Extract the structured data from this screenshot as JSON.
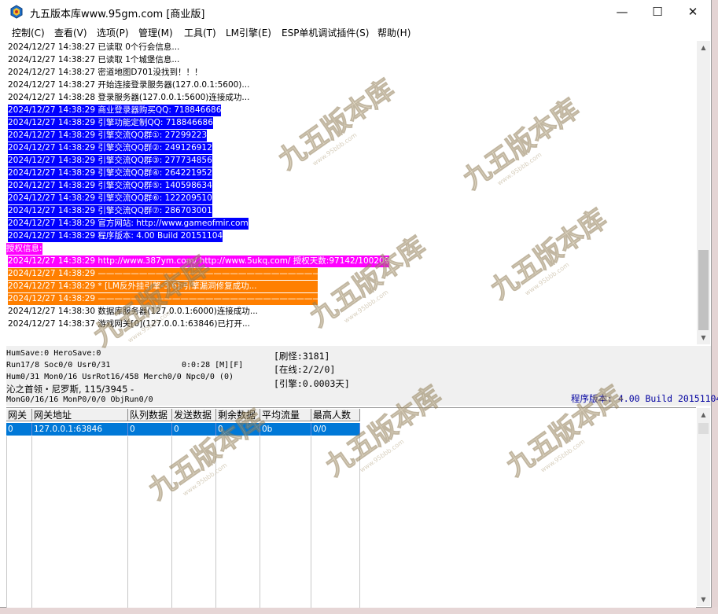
{
  "window": {
    "title": "九五版本库www.95gm.com [商业版]",
    "controls": {
      "minimize": "—",
      "maximize": "☐",
      "close": "✕"
    }
  },
  "menu": [
    "控制(C)",
    "查看(V)",
    "选项(P)",
    "管理(M)",
    "工具(T)",
    "LM引擎(E)",
    "ESP单机调试插件(S)",
    "帮助(H)"
  ],
  "log": [
    {
      "text": "2024/12/27 14:38:27 已读取 0个行会信息...",
      "fg": "#000000",
      "bg": ""
    },
    {
      "text": "2024/12/27 14:38:27 已读取 1个城堡信息...",
      "fg": "#000000",
      "bg": ""
    },
    {
      "text": "2024/12/27 14:38:27 密道地图D701没找到！！！",
      "fg": "#000000",
      "bg": ""
    },
    {
      "text": "2024/12/27 14:38:27 开始连接登录服务器(127.0.0.1:5600)...",
      "fg": "#000000",
      "bg": ""
    },
    {
      "text": "2024/12/27 14:38:28 登录服务器(127.0.0.1:5600)连接成功...",
      "fg": "#000000",
      "bg": ""
    },
    {
      "text": "2024/12/27 14:38:29 商业登录器购买QQ: 718846686",
      "fg": "#ffffff",
      "bg": "#0000ff"
    },
    {
      "text": "2024/12/27 14:38:29 引擎功能定制QQ: 718846686",
      "fg": "#ffffff",
      "bg": "#0000ff"
    },
    {
      "text": "2024/12/27 14:38:29 引擎交流QQ群①: 27299223",
      "fg": "#ffffff",
      "bg": "#0000ff"
    },
    {
      "text": "2024/12/27 14:38:29 引擎交流QQ群②: 249126912",
      "fg": "#ffffff",
      "bg": "#0000ff"
    },
    {
      "text": "2024/12/27 14:38:29 引擎交流QQ群③: 277734856",
      "fg": "#ffffff",
      "bg": "#0000ff"
    },
    {
      "text": "2024/12/27 14:38:29 引擎交流QQ群④: 264221952",
      "fg": "#ffffff",
      "bg": "#0000ff"
    },
    {
      "text": "2024/12/27 14:38:29 引擎交流QQ群⑤: 140598634",
      "fg": "#ffffff",
      "bg": "#0000ff"
    },
    {
      "text": "2024/12/27 14:38:29 引擎交流QQ群⑥: 122209510",
      "fg": "#ffffff",
      "bg": "#0000ff"
    },
    {
      "text": "2024/12/27 14:38:29 引擎交流QQ群⑦: 286703001",
      "fg": "#ffffff",
      "bg": "#0000ff"
    },
    {
      "text": "2024/12/27 14:38:29 官方网站: http://www.gameofmir.com",
      "fg": "#ffffff",
      "bg": "#0000ff"
    },
    {
      "text": "2024/12/27 14:38:29 程序版本: 4.00 Build 20151104",
      "fg": "#ffffff",
      "bg": "#0000ff"
    },
    {
      "text": "授权信息:",
      "fg": "#ffffff",
      "bg": "#ff00ff"
    },
    {
      "text": "2024/12/27 14:38:29 http://www.387ym.com/ http://www.5ukq.com/ 授权天数:97142/100209",
      "fg": "#ffffff",
      "bg": "#ff00ff"
    },
    {
      "text": "2024/12/27 14:38:29 ———————————————————————————————",
      "fg": "#ffffff",
      "bg": "#ff7f00"
    },
    {
      "text": "2024/12/27 14:38:29 * [LM反外挂引擎-3.6]:引擎漏洞修复成功...",
      "fg": "#ffffff",
      "bg": "#ff7f00"
    },
    {
      "text": "2024/12/27 14:38:29 ———————————————————————————————",
      "fg": "#ffffff",
      "bg": "#ff7f00"
    },
    {
      "text": "2024/12/27 14:38:30 数据库服务器(127.0.0.1:6000)连接成功...",
      "fg": "#000000",
      "bg": ""
    },
    {
      "text": "2024/12/27 14:38:37 游戏网关[0](127.0.0.1:63846)已打开...",
      "fg": "#000000",
      "bg": ""
    }
  ],
  "status": {
    "line1": "HumSave:0 HeroSave:0",
    "line2": "Run17/8 Soc0/0 Usr0/31",
    "time": "0:0:28 [M][F]",
    "line3": "Hum0/31 Mon0/16 UsrRot16/458 Merch0/0 Npc0/0 (0)",
    "line4": "沁之首领・尼罗斯, 115/3945 -",
    "line5": "MonG0/16/16 MonP0/0/0 ObjRun0/0",
    "refresh": "[刷怪:3181]",
    "online": "[在线:2/2/0]",
    "engine": "[引擎:0.0003天]",
    "version": "程序版本: 4.00 Build 20151104"
  },
  "gateway_table": {
    "headers": [
      "网关",
      "网关地址",
      "队列数据",
      "发送数据",
      "剩余数据",
      "平均流量",
      "最高人数"
    ],
    "rows": [
      [
        "0",
        "127.0.0.1:63846",
        "0",
        "0",
        "0",
        "0b",
        "0/0"
      ]
    ]
  },
  "watermark": {
    "text": "九五版本库",
    "url": "www.95bbb.com"
  },
  "colors": {
    "selection": "#0078d7",
    "log_blue": "#0000ff",
    "log_magenta": "#ff00ff",
    "log_orange": "#ff7f00",
    "version_text": "#0000a0"
  }
}
